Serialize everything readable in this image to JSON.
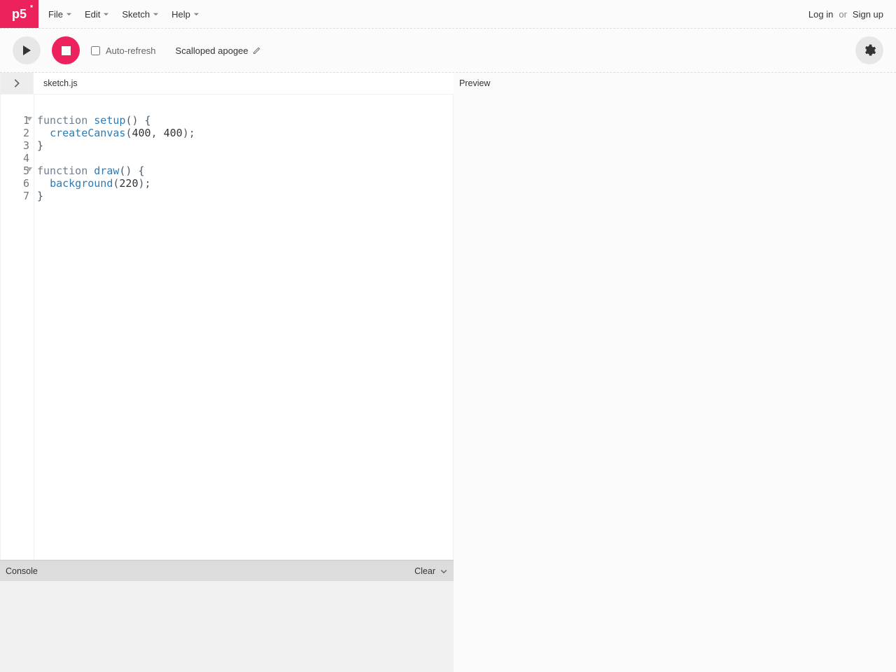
{
  "logo": {
    "text": "p5",
    "star": "*"
  },
  "menubar": {
    "items": [
      "File",
      "Edit",
      "Sketch",
      "Help"
    ]
  },
  "auth": {
    "login": "Log in",
    "or": "or",
    "signup": "Sign up"
  },
  "toolbar": {
    "auto_refresh_label": "Auto-refresh",
    "sketch_name": "Scalloped apogee"
  },
  "editor": {
    "filename": "sketch.js",
    "preview_label": "Preview",
    "line_numbers": [
      "1",
      "2",
      "3",
      "4",
      "5",
      "6",
      "7"
    ],
    "fold_lines": [
      1,
      5
    ],
    "code_lines": [
      {
        "tokens": [
          {
            "t": "function ",
            "c": "kw"
          },
          {
            "t": "setup",
            "c": "fn"
          },
          {
            "t": "() {",
            "c": "punct"
          }
        ]
      },
      {
        "tokens": [
          {
            "t": "  "
          },
          {
            "t": "createCanvas",
            "c": "call"
          },
          {
            "t": "(",
            "c": "punct"
          },
          {
            "t": "400",
            "c": "num"
          },
          {
            "t": ", ",
            "c": "punct"
          },
          {
            "t": "400",
            "c": "num"
          },
          {
            "t": ");",
            "c": "punct"
          }
        ]
      },
      {
        "tokens": [
          {
            "t": "}",
            "c": "punct"
          }
        ]
      },
      {
        "tokens": [
          {
            "t": ""
          }
        ]
      },
      {
        "tokens": [
          {
            "t": "function ",
            "c": "kw"
          },
          {
            "t": "draw",
            "c": "fn"
          },
          {
            "t": "() {",
            "c": "punct"
          }
        ]
      },
      {
        "tokens": [
          {
            "t": "  "
          },
          {
            "t": "background",
            "c": "call"
          },
          {
            "t": "(",
            "c": "punct"
          },
          {
            "t": "220",
            "c": "num"
          },
          {
            "t": ");",
            "c": "punct"
          }
        ]
      },
      {
        "tokens": [
          {
            "t": "}",
            "c": "punct"
          }
        ]
      }
    ]
  },
  "console": {
    "label": "Console",
    "clear": "Clear"
  }
}
